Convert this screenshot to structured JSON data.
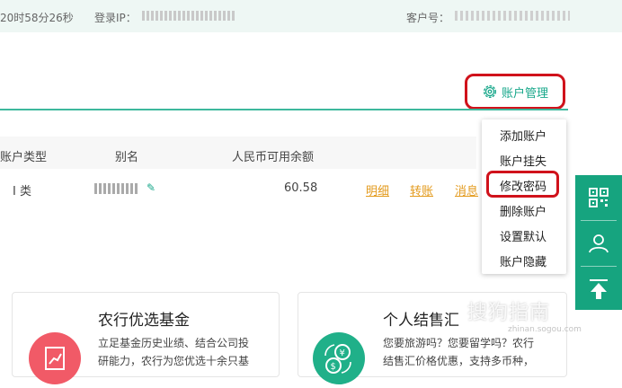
{
  "topbar": {
    "login_time": "20时58分26秒",
    "ip_label": "登录IP：",
    "customer_label": "客户号："
  },
  "account_management": {
    "label": "账户管理"
  },
  "table": {
    "headers": [
      "账户类型",
      "别名",
      "人民币可用余额"
    ],
    "row": {
      "type": "I 类",
      "balance": "60.58",
      "links": [
        "明细",
        "转账",
        "消息"
      ]
    }
  },
  "dropdown": {
    "items": [
      "添加账户",
      "账户挂失",
      "修改密码",
      "删除账户",
      "设置默认",
      "账户隐藏"
    ]
  },
  "cards": [
    {
      "title": "农行优选基金",
      "desc": [
        "立足基金历史业绩、结合公司投",
        "研能力，农行为您优选十余只基"
      ]
    },
    {
      "title": "个人结售汇",
      "desc": [
        "您要旅游吗？您要留学吗？农行",
        "结售汇价格优惠，支持多币种，"
      ]
    }
  ],
  "sidebar_icons": [
    "qr-code-icon",
    "user-group-icon",
    "back-to-top-icon"
  ],
  "watermark": {
    "text": "搜狗指南",
    "sub": "zhinan.sogou.com"
  },
  "colors": {
    "accent": "#17a78a",
    "highlight": "#d0121b",
    "link": "#e39a1c",
    "sidebar": "#16a47f"
  }
}
